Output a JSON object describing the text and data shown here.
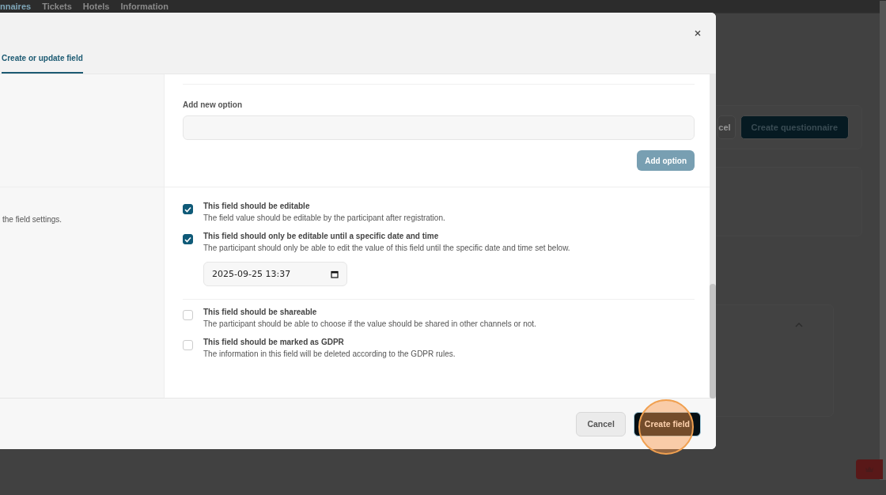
{
  "background": {
    "nav_items": [
      {
        "label": "nnaires",
        "selected": true
      },
      {
        "label": "Tickets",
        "selected": false
      },
      {
        "label": "Hotels",
        "selected": false
      },
      {
        "label": "Information",
        "selected": false
      }
    ],
    "buttons": [
      {
        "label": "cel",
        "kind": "secondary"
      },
      {
        "label": "Create questionnaire",
        "kind": "primary"
      }
    ]
  },
  "modal": {
    "tabs": [
      {
        "label": "Create or update field",
        "selected": true
      }
    ],
    "option_input": {
      "label": "Add new option"
    },
    "add_option_button": "Add option",
    "settings_description": "the field settings.",
    "setting_groups": [
      {
        "items": [
          {
            "title": "This field should be editable",
            "description": "The field value should be editable by the participant after registration.",
            "checked": true
          },
          {
            "title": "This field should only be editable until a specific date and time",
            "description": "The participant should only be able to edit the value of this field until the specific date and time set below.",
            "checked": true,
            "date_value": "2025-09-25 13:37"
          }
        ]
      },
      {
        "items": [
          {
            "title": "This field should be shareable",
            "description": "The participant should be able to choose if the value should be shared in other channels or not.",
            "checked": false
          },
          {
            "title": "This field should be marked as GDPR",
            "description": "The information in this field will be deleted according to the GDPR rules.",
            "checked": false
          }
        ]
      }
    ],
    "footer_buttons": [
      {
        "label": "Cancel",
        "kind": "secondary"
      },
      {
        "label": "Create field",
        "kind": "primary"
      }
    ]
  }
}
